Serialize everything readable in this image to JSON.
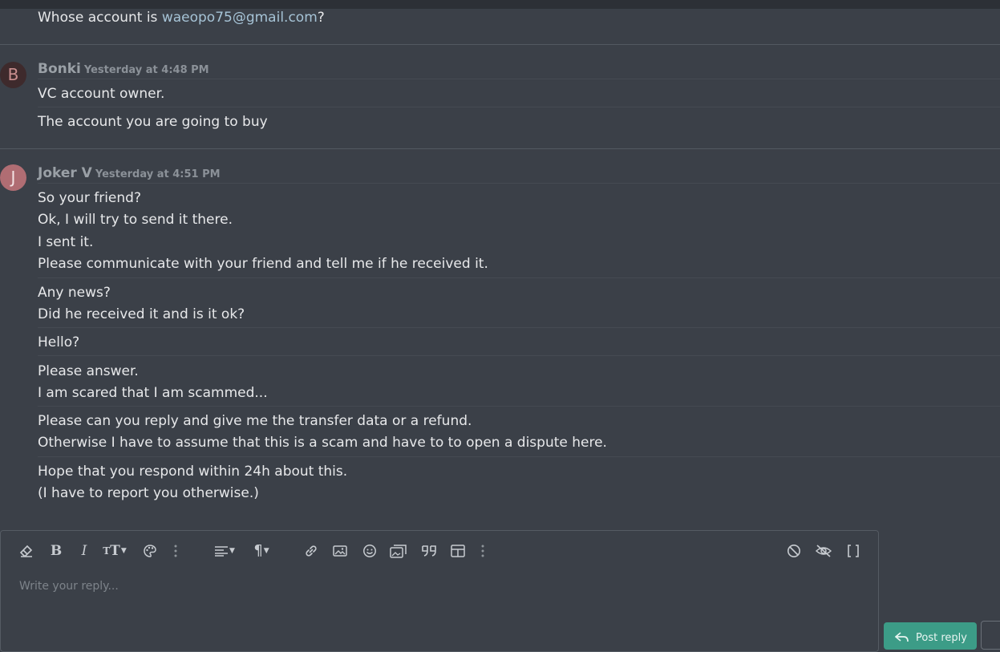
{
  "thread": {
    "prev_message": {
      "text_before": "Whose account is ",
      "email_link": "waeopo75@gmail.com",
      "text_after": "?"
    },
    "posts": [
      {
        "author": "Bonki",
        "avatar_letter": "B",
        "avatar_color": "#3e2a2c",
        "timestamp": "Yesterday at 4:48 PM",
        "lines": [
          "VC account owner.",
          "The account you are going to buy"
        ]
      },
      {
        "author": "Joker V",
        "avatar_letter": "J",
        "avatar_color": "#b06d73",
        "timestamp": "Yesterday at 4:51 PM",
        "lines": [
          "So your friend?",
          "Ok, I will try to send it there.",
          "I sent it.",
          "Please communicate with your friend and tell me if he received it.",
          "Any news?",
          "Did he received it and is it ok?",
          "Hello?",
          "Please answer.",
          "I am scared that I am scammed...",
          "Please can you reply and give me the transfer data or a refund.",
          "Otherwise I have to assume that this is a scam and have to to open a dispute here.",
          "Hope that you respond within 24h about this.",
          "(I have to report you otherwise.)"
        ]
      }
    ]
  },
  "editor": {
    "placeholder": "Write your reply...",
    "toolbar": [
      "eraser-icon",
      "bold-icon",
      "italic-icon",
      "text-size-icon",
      "palette-icon",
      "more-icon",
      "align-icon",
      "paragraph-icon",
      "link-icon",
      "image-icon",
      "smiley-icon",
      "media-icon",
      "quote-icon",
      "table-icon",
      "more-icon",
      "cancel-icon",
      "hide-icon",
      "brackets-icon"
    ],
    "post_reply_label": "Post reply"
  },
  "colors": {
    "background": "#3b4048",
    "link": "#a6c3d6",
    "accent_button": "#3c9c87"
  }
}
